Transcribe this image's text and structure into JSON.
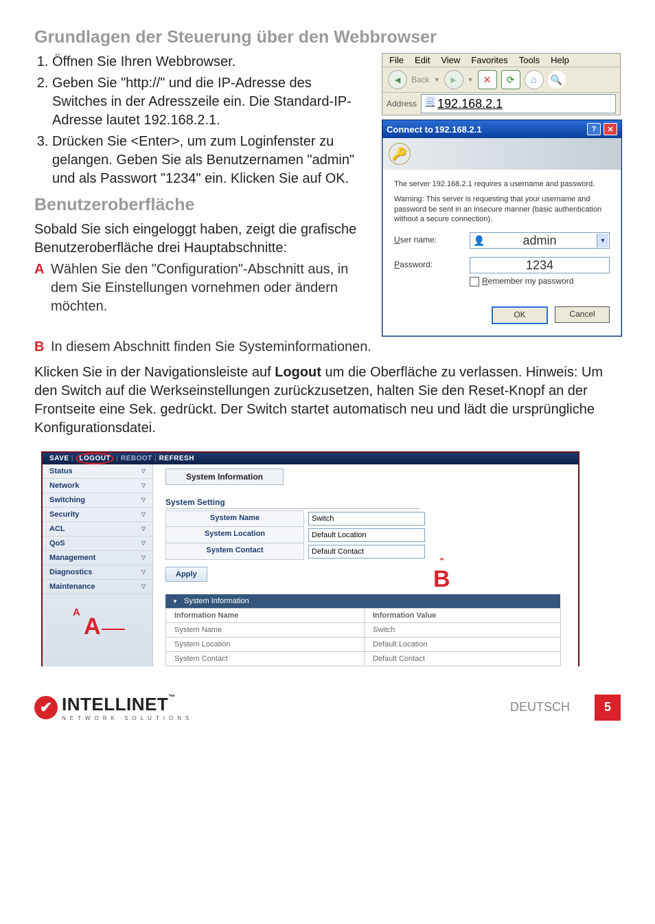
{
  "section1_title": "Grundlagen der Steuerung über den Webbrowser",
  "steps": [
    "Öffnen Sie Ihren Webbrowser.",
    "Geben Sie \"http://\" und die IP-Adresse des Switches in der Adresszeile ein. Die Standard-IP-Adresse lautet 192.168.2.1.",
    "Drücken Sie <Enter>, um zum Loginfenster zu gelangen. Geben Sie als Benutzernamen \"admin\" und als Passwort \"1234\" ein. Klicken Sie auf OK."
  ],
  "section2_title": "Benutzeroberfläche",
  "intro_after_login": "Sobald Sie sich eingeloggt haben, zeigt die grafische Benutzeroberfläche drei Hauptabschnitte:",
  "point_A": "Wählen Sie den \"Configuration\"-Abschnitt aus, in dem Sie Einstellungen vornehmen oder ändern möchten.",
  "point_B": "In diesem Abschnitt finden Sie Systeminformationen.",
  "logout_para_pre": "Klicken Sie in der Navigationsleiste auf ",
  "logout_word": "Logout",
  "logout_para_post": " um die Oberfläche zu verlassen. Hinweis: Um den Switch auf die Werkseinstellungen zurück­zusetzen, halten Sie den Reset-Knopf an der Frontseite eine Sek. gedrückt. Der Switch startet automatisch neu und lädt die ursprüngliche Konfigurationsdatei.",
  "browser": {
    "menus": [
      "File",
      "Edit",
      "View",
      "Favorites",
      "Tools",
      "Help"
    ],
    "back_label": "Back",
    "address_label": "Address",
    "address_value": "192.168.2.1"
  },
  "dialog": {
    "title_pre": "Connect to ",
    "title_ip": "192.168.2.1",
    "msg1": "The server  192.168.2.1  requires a username and password.",
    "msg2": "Warning: This server is requesting that your username and password be sent in an insecure manner (basic authentication without a secure connection).",
    "username_label": "User name:",
    "password_label": "Password:",
    "username_value": "admin",
    "password_value": "1234",
    "remember_label": "Remember my password",
    "ok": "OK",
    "cancel": "Cancel"
  },
  "switch": {
    "topbar": [
      "SAVE",
      "LOGOUT",
      "REBOOT",
      "REFRESH"
    ],
    "nav": [
      "Status",
      "Network",
      "Switching",
      "Security",
      "ACL",
      "QoS",
      "Management",
      "Diagnostics",
      "Maintenance"
    ],
    "tab_header": "System Information",
    "block_title": "System Setting",
    "settings": [
      {
        "label": "System Name",
        "value": "Switch"
      },
      {
        "label": "System Location",
        "value": "Default Location"
      },
      {
        "label": "System Contact",
        "value": "Default Contact"
      }
    ],
    "apply": "Apply",
    "info_band": "System Information",
    "info_header_name": "Information Name",
    "info_header_value": "Information Value",
    "info_rows": [
      {
        "name": "System Name",
        "value": "Switch"
      },
      {
        "name": "System Location",
        "value": "Default Location"
      },
      {
        "name": "System Contact",
        "value": "Default Contact"
      }
    ]
  },
  "callouts": {
    "A_small": "A",
    "A": "A",
    "B": "B",
    "B_caret": "ˆ"
  },
  "footer": {
    "brand_main": "INTELLINET",
    "brand_sub": "NETWORK SOLUTIONS",
    "tm": "™",
    "lang": "DEUTSCH",
    "page": "5"
  }
}
